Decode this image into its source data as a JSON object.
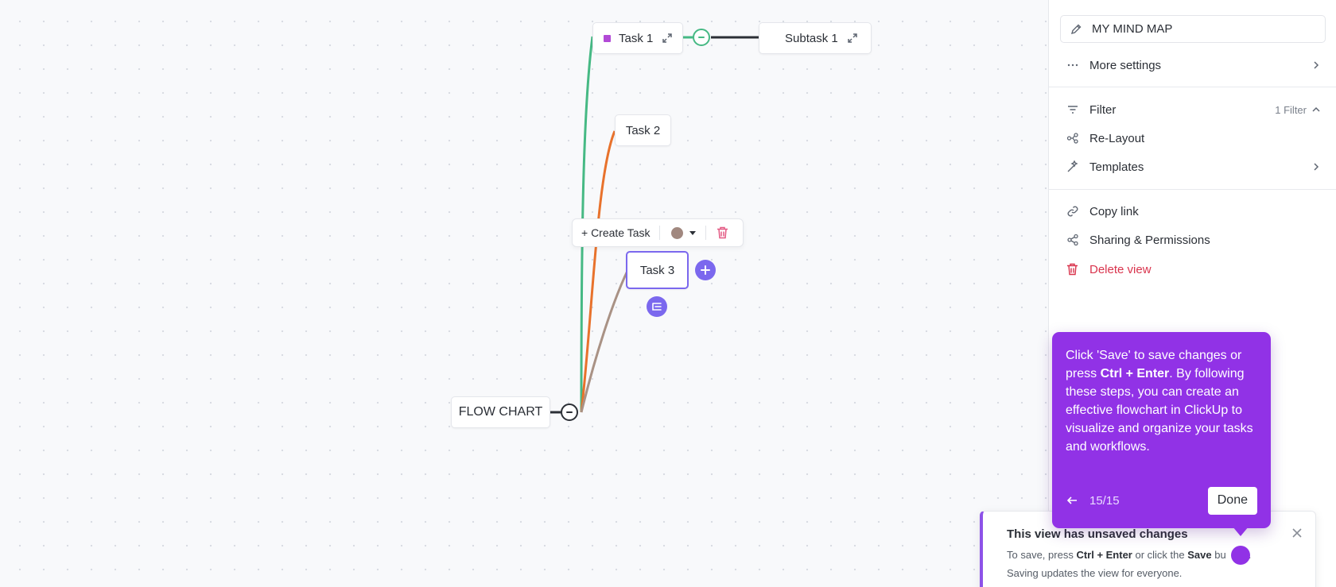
{
  "mindmap": {
    "root": {
      "label": "FLOW CHART"
    },
    "tasks": [
      {
        "label": "Task 1",
        "color": "#b24ad6"
      },
      {
        "label": "Task 2"
      },
      {
        "label": "Task 3"
      }
    ],
    "subtask": {
      "label": "Subtask 1"
    },
    "toolbar": {
      "create_label": "+ Create Task",
      "selected_color": "#a1887f"
    },
    "colors": {
      "task1_branch": "#46b984",
      "task2_branch": "#e8722c",
      "task3_branch": "#a99285",
      "accent": "#7b68ee"
    }
  },
  "panel": {
    "view_name": "MY MIND MAP",
    "items": [
      {
        "label": "More settings",
        "icon": "more-icon"
      },
      {
        "label": "Filter",
        "icon": "filter-icon",
        "extra": "1 Filter"
      },
      {
        "label": "Re-Layout",
        "icon": "relayout-icon"
      },
      {
        "label": "Templates",
        "icon": "templates-icon"
      },
      {
        "label": "Copy link",
        "icon": "link-icon"
      },
      {
        "label": "Sharing & Permissions",
        "icon": "share-icon"
      },
      {
        "label": "Delete view",
        "icon": "trash-icon"
      }
    ]
  },
  "tooltip": {
    "text_before": "Click 'Save' to save changes or press ",
    "text_bold": "Ctrl + Enter",
    "text_after": ". By following these steps, you can create an effective flowchart in ClickUp to visualize and organize your tasks and workflows.",
    "step": "15/15",
    "done_label": "Done",
    "color": "#9132e6"
  },
  "banner": {
    "title": "This view has unsaved changes",
    "line1_a": "To save, press ",
    "line1_b": "Ctrl + Enter",
    "line1_c": " or click the ",
    "line1_d": "Save",
    "line1_e": " bu",
    "line1_f": ".",
    "line2": "Saving updates the view for everyone."
  }
}
